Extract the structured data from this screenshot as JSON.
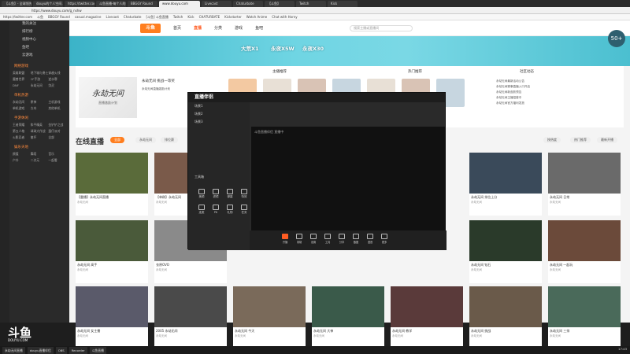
{
  "browser": {
    "tabs": [
      "【斗鱼】- 全球领先的...",
      "douyu的个人空间...",
      "https://twitter.com",
      "斗鱼直播-每个人的...",
      "BBGGY Round",
      "www.douyu.com",
      "Livecast",
      "Chaturbate",
      "【斗鱼】",
      "Twitch",
      "Kick"
    ],
    "address": "https://www.douyu.com/g_nshw",
    "bookmarks": [
      "https://twitter.com",
      "斗鱼",
      "BBGGY Round",
      "casual.magazine",
      "Livecast",
      "Chaturbate",
      "[斗鱼] 斗鱼直播",
      "Twitch",
      "Kick",
      "CHATURBATE",
      "Kickstarter",
      "Watch Anime",
      "Chat with Horny"
    ]
  },
  "sidebar": {
    "top_items": [
      "我的关注",
      "排行榜",
      "视频中心",
      "鱼吧",
      "云游戏"
    ],
    "sections": [
      {
        "title": "网络游戏",
        "games": [
          "英雄联盟",
          "地下城与勇士",
          "穿越火线",
          "魔兽世界",
          "CF手游",
          "逆水寒",
          "DNF",
          "永劫无间",
          "剑灵"
        ]
      },
      {
        "title": "单机热游",
        "games": [
          "永劫无间",
          "原神",
          "主机游戏",
          "单机游戏",
          "方舟",
          "其他单机"
        ]
      },
      {
        "title": "手游休闲",
        "games": [
          "王者荣耀",
          "和平精英",
          "金铲铲之战",
          "第五人格",
          "球球大作战",
          "蛋仔派对",
          "火影忍者",
          "崩坏",
          "全部"
        ]
      },
      {
        "title": "娱乐天地",
        "games": [
          "颜值",
          "舞蹈",
          "音乐",
          "户外",
          "二次元",
          "一起看"
        ]
      }
    ]
  },
  "logo": {
    "text": "斗鱼",
    "sub": "DOUYU.COM"
  },
  "site": {
    "brand": "斗鱼",
    "nav": [
      "首页",
      "直播",
      "分类",
      "游戏",
      "鱼吧"
    ],
    "nav_active": 1,
    "search_placeholder": "搜索主播或直播间",
    "banner": [
      "大荒X1",
      "永夜X5W",
      "永夜X30"
    ],
    "badge": "50+"
  },
  "feature": {
    "image_text": "永劫无间",
    "image_sub": "直播激励计划",
    "title": "永劫无间 挑战一等奖",
    "desc": "永劫无间直播激励计划",
    "col1_title": "主播推荐",
    "col2_title": "热门推荐",
    "col3_title": "社区动态",
    "notices": [
      "永劫无间最新活动公告",
      "永劫无间赛事直播入口开启",
      "永劫无间新皮肤预告",
      "永劫无间主播招募中",
      "永劫无间官方福利发放"
    ]
  },
  "live": {
    "title": "在线直播",
    "filters": [
      "全部",
      "永劫无间",
      "排位赛"
    ],
    "filter_active": 0,
    "right_filters": [
      "按热度",
      "热门推荐",
      "最新开播"
    ],
    "cards": [
      {
        "title": "【重播】永劫无间直播",
        "meta": "永劫无间"
      },
      {
        "title": "【单刷】永劫无间",
        "meta": "永劫无间"
      },
      {
        "title": "永劫无间 排位上分",
        "meta": "永劫无间"
      },
      {
        "title": "永劫无间 日常",
        "meta": "永劫无间"
      },
      {
        "title": "永劫无间 高手",
        "meta": "永劫无间"
      },
      {
        "title": "衣原OVO",
        "meta": "永劫无间"
      },
      {
        "title": "永劫无间 钻石",
        "meta": "永劫无间"
      },
      {
        "title": "永劫无间 一起玩",
        "meta": "永劫无间"
      },
      {
        "title": "永劫无间 女主播",
        "meta": "永劫无间"
      },
      {
        "title": "2005 永劫无间",
        "meta": "永劫无间"
      },
      {
        "title": "永劫无间 今天",
        "meta": "永劫无间"
      },
      {
        "title": "永劫无间 大神",
        "meta": "永劫无间"
      },
      {
        "title": "永劫无间 教学",
        "meta": "永劫无间"
      },
      {
        "title": "永劫无间 挑战",
        "meta": "永劫无间"
      },
      {
        "title": "永劫无间 三排",
        "meta": "永劫无间"
      },
      {
        "title": "【单刷】永劫无间",
        "meta": "永劫无间"
      },
      {
        "title": "永劫无间 娱乐",
        "meta": "永劫无间"
      },
      {
        "title": "永劫无间 冲分",
        "meta": "永劫无间"
      },
      {
        "title": "永劫无间 夜场",
        "meta": "永劫无间"
      },
      {
        "title": "【单刷】永劫无间",
        "meta": "永劫无间"
      },
      {
        "title": "永劫无间 新手",
        "meta": "永劫无间"
      },
      {
        "title": "【大会员】永劫无间",
        "meta": "永劫无间"
      }
    ]
  },
  "app": {
    "title": "直播伴侣",
    "tabs": [
      "场景1",
      "场景2",
      "场景3"
    ],
    "preview_label": "斗鱼直播伴侣 直播中",
    "left_tools_title": "工具箱",
    "tools": [
      "美颜",
      "滤镜",
      "弹幕",
      "特效",
      "连麦",
      "PK",
      "礼物",
      "任务"
    ],
    "bottom": [
      "开播",
      "录制",
      "设置",
      "工具",
      "分享",
      "截图",
      "语音",
      "更多"
    ]
  },
  "taskbar": {
    "items": [
      "永劫无间直播",
      "douyu直播伴侣",
      "OBS",
      "Recorder",
      "斗鱼直播"
    ],
    "clock": "17:43"
  },
  "colors": {
    "accent": "#ff7e1f",
    "hot": "#ff5d23"
  }
}
